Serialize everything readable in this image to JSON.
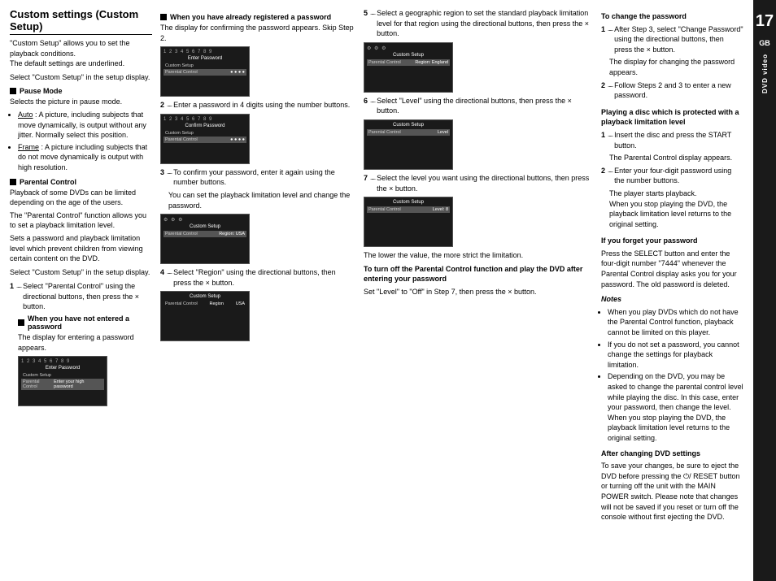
{
  "page": {
    "number": "17",
    "sidebar_label": "DVD video",
    "gb_label": "GB"
  },
  "left_col": {
    "title": "Custom settings (Custom Setup)",
    "intro": "\"Custom Setup\" allows you to set the playback conditions.\nThe default settings are underlined.",
    "select_text": "Select \"Custom Setup\" in the setup display.",
    "pause_mode_header": "Pause Mode",
    "pause_mode_desc": "Selects the picture in pause mode.",
    "pause_bullets": [
      "Auto : A picture, including subjects that move dynamically, is output without any jitter. Normally select this position.",
      "Frame : A picture including subjects that do not move dynamically is output with high resolution."
    ],
    "parental_header": "Parental Control",
    "parental_desc1": "Playback of some DVDs can be limited depending on the age of the users.",
    "parental_desc2": "The \"Parental Control\" function allows you to set a playback limitation level.",
    "parental_desc3": "Sets a password and playback limitation level which prevent children from viewing certain content on the DVD.",
    "parental_select": "Select \"Custom Setup\" in the setup display.",
    "step1_text": "Select \"Parental Control\" using the directional buttons, then press the × button.",
    "no_password_header": "When you have not entered a password",
    "no_password_text": "The display for entering a password appears."
  },
  "middle_col": {
    "step_already_registered_header": "When you have already registered a password",
    "step_already_registered_text": "The display for confirming the password appears.  Skip Step 2.",
    "step2_text": "Enter a password in 4 digits using the number buttons.",
    "step3_text": "To confirm your password, enter it again using the number buttons.",
    "step3_sub": "You can set the playback limitation level and change the password.",
    "step4_text": "Select \"Region\" using the directional buttons, then press the × button."
  },
  "right_col": {
    "step5_text": "Select a geographic region to set the standard playback limitation level for that region using the directional buttons, then press the × button.",
    "step6_text": "Select \"Level\" using the directional buttons, then press the × button.",
    "step7_text": "Select the level you want using the directional buttons, then press the × button.",
    "lower_value_text": "The lower the value, the more strict the limitation.",
    "turn_off_header": "To turn off the Parental Control function and play the DVD after entering your password",
    "turn_off_text": "Set \"Level\" to \"Off\" in Step 7, then press the × button."
  },
  "far_right_col": {
    "change_password_header": "To change the password",
    "change_step1": "After Step 3, select \"Change Password\" using the directional buttons, then press the × button.",
    "change_step1b": "The display for changing the password appears.",
    "change_step2": "Follow Steps 2 and 3 to enter a new password.",
    "protected_header": "Playing a disc which is protected with a playback limitation level",
    "protected_step1": "Insert the disc and press the START button.",
    "protected_step1b": "The Parental Control display appears.",
    "protected_step2": "Enter your four-digit password using the number buttons.",
    "protected_step2b": "The player starts playback.\nWhen you stop playing the DVD, the playback limitation level returns to the original setting.",
    "forget_header": "If you forget your password",
    "forget_text": "Press the SELECT button and enter the four-digit number \"7444\" whenever the Parental Control display asks you for your password. The old password is deleted.",
    "notes_header": "Notes",
    "notes": [
      "When you play DVDs which do not have the Parental Control function, playback cannot be limited on this player.",
      "If you do not set a password, you cannot change the settings for playback limitation.",
      "Depending on the DVD, you may be asked to change the parental control level while playing the disc.  In this case, enter your password, then change the level. When you stop playing the DVD, the playback limitation level returns to the original setting."
    ],
    "after_header": "After changing DVD settings",
    "after_text": "To save your changes, be sure to eject the DVD before pressing the ⏻/ RESET button or turning off the unit with the MAIN POWER switch.  Please note that changes will not be saved if you reset or turn off the console without first ejecting the DVD."
  },
  "screens": {
    "screen1_title": "Enter Password",
    "screen2_title": "Confirm Password",
    "screen3_title": "Confirm Password",
    "screen4_title": "Region",
    "screen5_title": "Region",
    "screen6_title": "Level",
    "screen7_title": "Level"
  }
}
